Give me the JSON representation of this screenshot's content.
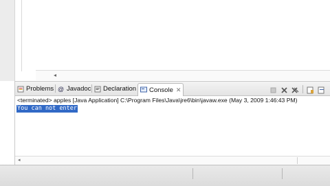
{
  "views": {
    "tabs": [
      {
        "label": "Problems",
        "icon": "problems-icon"
      },
      {
        "label": "Javadoc",
        "icon": "at-sign-icon"
      },
      {
        "label": "Declaration",
        "icon": "declaration-icon"
      },
      {
        "label": "Console",
        "icon": "console-icon",
        "active": true,
        "close_glyph": "✕"
      }
    ]
  },
  "console": {
    "status": "<terminated> apples [Java Application] C:\\Program Files\\Java\\jre6\\bin\\javaw.exe (May 3, 2009 1:46:43 PM)",
    "output_line": "You can not enter",
    "selection_color": "#3169c6",
    "toolbar_icons": [
      "terminate-icon",
      "remove-launch-icon",
      "remove-all-terminated-icon",
      "scroll-lock-icon",
      "pin-console-icon"
    ]
  },
  "colors": {
    "accent_selection": "#3169c6",
    "tab_background": "#e4e4e4"
  }
}
